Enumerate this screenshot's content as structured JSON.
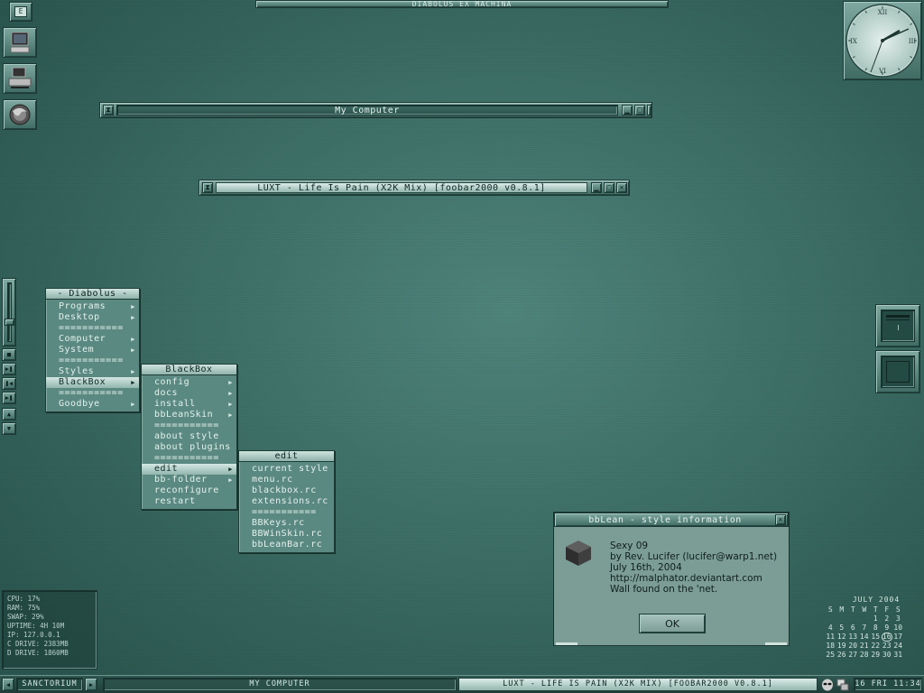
{
  "top_title": "DIABOLUS EX MACHINA",
  "windows": {
    "my_computer": {
      "title": "My Computer"
    },
    "foobar": {
      "title": "LUXT - Life Is Pain (X2K Mix)     [foobar2000 v0.8.1]"
    }
  },
  "diabolus_menu": {
    "title": "- Diabolus -",
    "items": [
      "Programs",
      "Desktop",
      "===========",
      "Computer",
      "System",
      "===========",
      "Styles",
      "BlackBox",
      "===========",
      "Goodbye"
    ]
  },
  "blackbox_menu": {
    "title": "BlackBox",
    "items": [
      "config",
      "docs",
      "install",
      "bbLeanSkin",
      "===========",
      "about style",
      "about plugins",
      "===========",
      "edit",
      "bb-folder",
      "reconfigure",
      "restart"
    ]
  },
  "edit_menu": {
    "title": "edit",
    "items": [
      "current style",
      "menu.rc",
      "blackbox.rc",
      "extensions.rc",
      "===========",
      "BBKeys.rc",
      "BBWinSkin.rc",
      "bbLeanBar.rc"
    ]
  },
  "dialog": {
    "title": "bbLean - style information",
    "lines": [
      "Sexy 09",
      "by Rev. Lucifer (lucifer@warp1.net)",
      "July 16th, 2004",
      "http://malphator.deviantart.com",
      "Wall found on the 'net."
    ],
    "ok_label": "OK"
  },
  "sysinfo": [
    "CPU: 17%",
    "RAM: 75%",
    "SWAP: 29%",
    "UPTIME: 4H 10M",
    "IP: 127.0.0.1",
    "C DRIVE: 2383MB",
    "D DRIVE: 1860MB"
  ],
  "calendar": {
    "title": "JULY 2004",
    "weekdays": [
      "S",
      "M",
      "T",
      "W",
      "T",
      "F",
      "S"
    ],
    "weeks": [
      [
        "",
        "",
        "",
        "",
        "1",
        "2",
        "3"
      ],
      [
        "4",
        "5",
        "6",
        "7",
        "8",
        "9",
        "10"
      ],
      [
        "11",
        "12",
        "13",
        "14",
        "15",
        "16",
        "17"
      ],
      [
        "18",
        "19",
        "20",
        "21",
        "22",
        "23",
        "24"
      ],
      [
        "25",
        "26",
        "27",
        "28",
        "29",
        "30",
        "31"
      ]
    ],
    "today": "16"
  },
  "clock": {
    "numerals": [
      "XII",
      "III",
      "VI",
      "IX"
    ]
  },
  "taskbar": {
    "workspace": "SANCTORIUM",
    "task_my_computer": "MY COMPUTER",
    "task_foobar": "LUXT - LIFE IS PAIN (X2K MIX)     [FOOBAR2000 V0.8.1]",
    "clock": "16 FRI 11:34"
  },
  "icons": {
    "left_bar": [
      "workspace-icon",
      "computer-icon",
      "network-icon",
      "firefox-icon"
    ],
    "media": [
      "stop-icon",
      "play-pause-icon",
      "previous-icon",
      "next-icon",
      "volume-up-icon",
      "volume-down-icon"
    ]
  },
  "colors": {
    "accent": "#4a7f76",
    "menu_bg": "#5a8981",
    "highlight": "#cfe3de",
    "dialog_bg": "#7c9c96"
  }
}
